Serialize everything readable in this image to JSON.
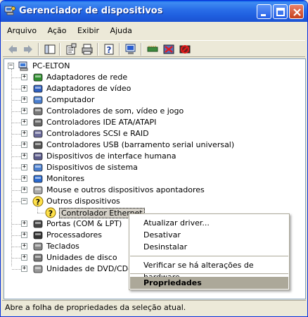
{
  "window": {
    "title": "Gerenciador de dispositivos"
  },
  "menubar": {
    "items": [
      "Arquivo",
      "Ação",
      "Exibir",
      "Ajuda"
    ]
  },
  "toolbar": {
    "icons": [
      "back-arrow-icon",
      "forward-arrow-icon",
      "show-hide-tree-icon",
      "properties-icon",
      "print-icon",
      "help-icon",
      "scan-hardware-icon",
      "update-driver-icon",
      "uninstall-icon",
      "disable-icon"
    ]
  },
  "tree": {
    "root": "PC-ELTON",
    "categories": [
      "Adaptadores de rede",
      "Adaptadores de vídeo",
      "Computador",
      "Controladores de som, vídeo e jogo",
      "Controladores IDE ATA/ATAPI",
      "Controladores SCSI e RAID",
      "Controladores USB (barramento serial universal)",
      "Dispositivos de interface humana",
      "Dispositivos de sistema",
      "Monitores",
      "Mouse e outros dispositivos apontadores",
      "Outros dispositivos",
      "Portas (COM & LPT)",
      "Processadores",
      "Teclados",
      "Unidades de disco",
      "Unidades de DVD/CD-ROM"
    ],
    "expanded_child": "Controlador Ethernet"
  },
  "context_menu": {
    "items": [
      "Atualizar driver...",
      "Desativar",
      "Desinstalar",
      "Verificar se há alterações de hardware",
      "Propriedades"
    ],
    "highlighted": "Propriedades"
  },
  "statusbar": {
    "text": "Abre a folha de propriedades da seleção atual."
  },
  "colors": {
    "titlebar": "#2a6fe8",
    "window_bg": "#ece9d8",
    "highlight": "#aca899",
    "tree_bg": "#ffffff"
  }
}
